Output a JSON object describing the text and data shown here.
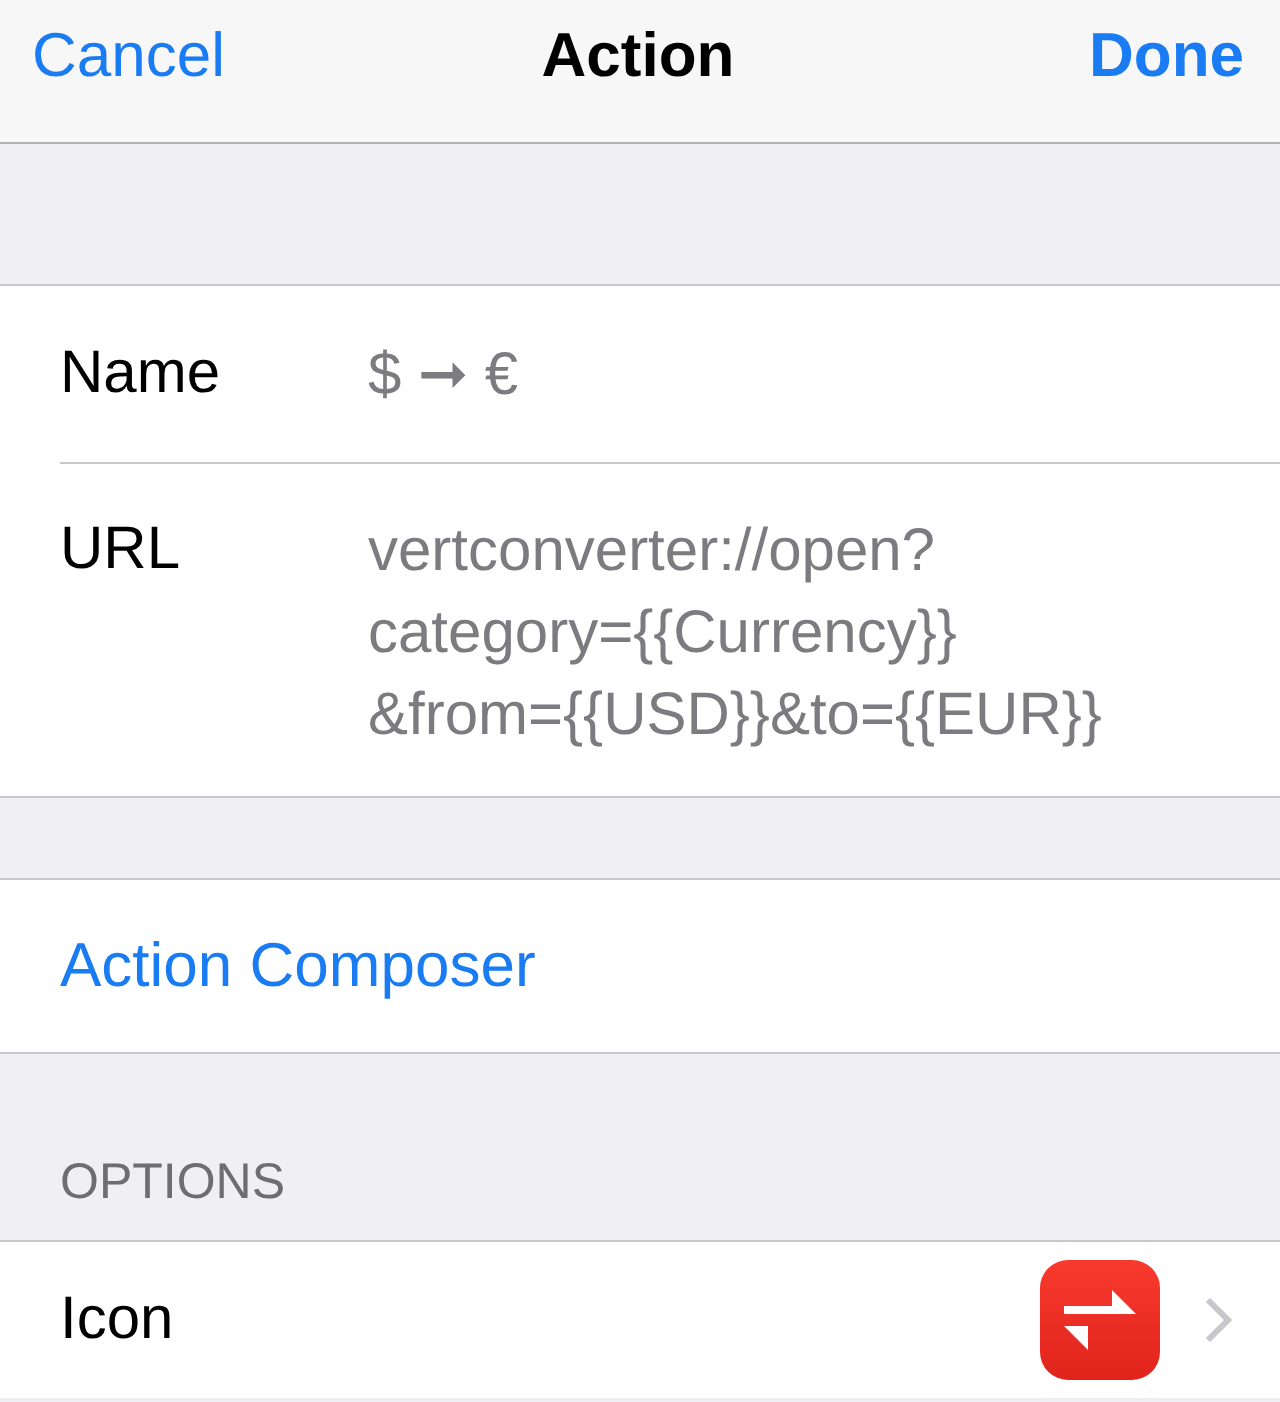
{
  "nav_bar": {
    "cancel": "Cancel",
    "title": "Action",
    "done": "Done"
  },
  "fields": [
    {
      "label": "Name",
      "value_lines": [
        "$ ➞ €"
      ]
    },
    {
      "label": "URL",
      "value_lines": [
        "vertconverter://open?",
        "category={{Currency}}",
        "&from={{USD}}&to={{EUR}}"
      ]
    }
  ],
  "composer_link": "Action Composer",
  "options": {
    "header": "OPTIONS",
    "rows": [
      {
        "label": "Icon",
        "kind": "icon"
      }
    ]
  }
}
